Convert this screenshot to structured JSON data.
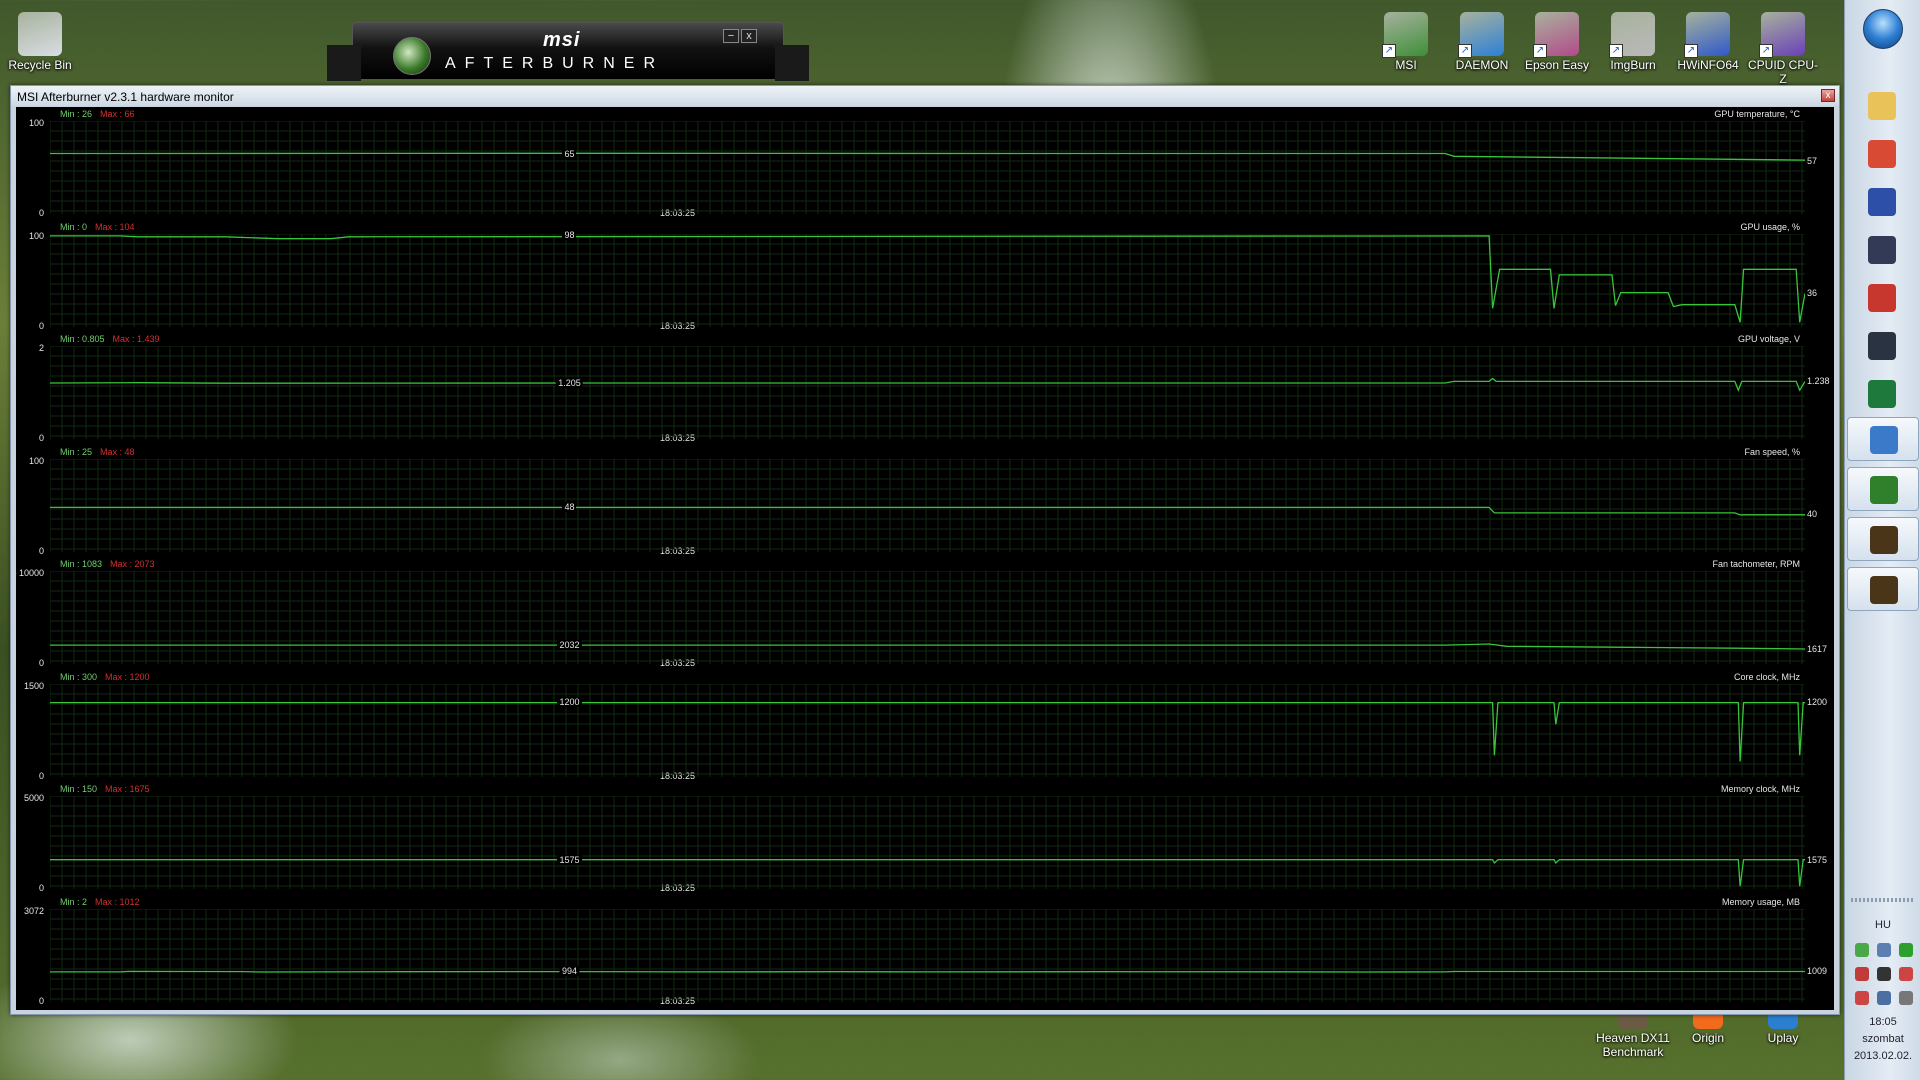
{
  "desktop": {
    "top_icons": [
      {
        "label": "Recycle Bin",
        "icon": "recycle-bin-icon",
        "color": "#d8dde3"
      },
      {
        "label": "MSI",
        "icon": "msi-icon",
        "color": "#3e8e3a"
      },
      {
        "label": "DAEMON",
        "icon": "daemon-tools-icon",
        "color": "#2c7fd8"
      },
      {
        "label": "Epson Easy",
        "icon": "epson-icon",
        "color": "#b24a8a"
      },
      {
        "label": "ImgBurn",
        "icon": "imgburn-icon",
        "color": "#b9b9b9"
      },
      {
        "label": "HWiNFO64",
        "icon": "hwinfo-icon",
        "color": "#2e58c9"
      },
      {
        "label": "CPUID CPU-Z",
        "icon": "cpuz-icon",
        "color": "#6a3fb8"
      }
    ],
    "bottom_icons": [
      {
        "label": "Heaven DX11 Benchmark",
        "icon": "heaven-icon",
        "color": "#6b5a44"
      },
      {
        "label": "Origin",
        "icon": "origin-icon",
        "color": "#f26a1b"
      },
      {
        "label": "Uplay",
        "icon": "uplay-icon",
        "color": "#2a7fd0"
      }
    ]
  },
  "afterburner_skin": {
    "logo_top": "msi",
    "logo_bottom": "AFTERBURNER",
    "minimize_glyph": "−",
    "close_glyph": "x"
  },
  "monitor_window": {
    "title": "MSI Afterburner v2.3.1 hardware monitor",
    "close_glyph": "x",
    "timestamp": "18:03:25",
    "graphs": [
      {
        "name": "GPU temperature, °C",
        "min_label": "Min : 26",
        "max_label": "Max : 66",
        "y_max": "100",
        "y_min": "0",
        "mid_value": "65",
        "current_value": "57",
        "range": [
          0,
          100
        ],
        "points": [
          [
            0,
            65
          ],
          [
            0.3,
            65.3
          ],
          [
            0.6,
            65
          ],
          [
            0.795,
            65
          ],
          [
            0.8,
            62
          ],
          [
            0.9,
            60
          ],
          [
            1,
            58
          ]
        ]
      },
      {
        "name": "GPU usage, %",
        "min_label": "Min : 0",
        "max_label": "Max : 104",
        "y_max": "100",
        "y_min": "0",
        "mid_value": "98",
        "current_value": "36",
        "range": [
          0,
          100
        ],
        "points": [
          [
            0,
            98
          ],
          [
            0.04,
            98
          ],
          [
            0.05,
            97
          ],
          [
            0.1,
            97
          ],
          [
            0.13,
            95
          ],
          [
            0.16,
            95
          ],
          [
            0.17,
            97
          ],
          [
            0.82,
            98
          ],
          [
            0.822,
            20
          ],
          [
            0.826,
            62
          ],
          [
            0.855,
            62
          ],
          [
            0.857,
            20
          ],
          [
            0.86,
            56
          ],
          [
            0.89,
            56
          ],
          [
            0.892,
            23
          ],
          [
            0.895,
            37
          ],
          [
            0.922,
            37
          ],
          [
            0.925,
            22
          ],
          [
            0.93,
            24
          ],
          [
            0.96,
            24
          ],
          [
            0.963,
            5
          ],
          [
            0.965,
            62
          ],
          [
            0.995,
            62
          ],
          [
            0.997,
            5
          ],
          [
            1,
            36
          ]
        ]
      },
      {
        "name": "GPU voltage, V",
        "min_label": "Min : 0.805",
        "max_label": "Max : 1.439",
        "y_max": "2",
        "y_min": "0",
        "mid_value": "1.205",
        "current_value": "1.238",
        "range": [
          0,
          2
        ],
        "points": [
          [
            0,
            1.205
          ],
          [
            0.05,
            1.21
          ],
          [
            0.1,
            1.2
          ],
          [
            0.3,
            1.205
          ],
          [
            0.795,
            1.205
          ],
          [
            0.8,
            1.238
          ],
          [
            0.82,
            1.24
          ],
          [
            0.822,
            1.3
          ],
          [
            0.824,
            1.238
          ],
          [
            0.96,
            1.238
          ],
          [
            0.962,
            1.05
          ],
          [
            0.964,
            1.238
          ],
          [
            0.995,
            1.238
          ],
          [
            0.997,
            1.05
          ],
          [
            1,
            1.238
          ]
        ]
      },
      {
        "name": "Fan speed, %",
        "min_label": "Min : 25",
        "max_label": "Max : 48",
        "y_max": "100",
        "y_min": "0",
        "mid_value": "48",
        "current_value": "40",
        "range": [
          0,
          100
        ],
        "points": [
          [
            0,
            48
          ],
          [
            0.82,
            48
          ],
          [
            0.823,
            42
          ],
          [
            0.96,
            42
          ],
          [
            0.963,
            40
          ],
          [
            1,
            40
          ]
        ]
      },
      {
        "name": "Fan tachometer, RPM",
        "min_label": "Min : 1083",
        "max_label": "Max : 2073",
        "y_max": "10000",
        "y_min": "0",
        "mid_value": "2032",
        "current_value": "1617",
        "range": [
          0,
          10000
        ],
        "points": [
          [
            0,
            2032
          ],
          [
            0.795,
            2032
          ],
          [
            0.82,
            2150
          ],
          [
            0.83,
            1900
          ],
          [
            0.9,
            1800
          ],
          [
            0.96,
            1700
          ],
          [
            1,
            1617
          ]
        ]
      },
      {
        "name": "Core clock, MHz",
        "min_label": "Min : 300",
        "max_label": "Max : 1200",
        "y_max": "1500",
        "y_min": "0",
        "mid_value": "1200",
        "current_value": "1200",
        "range": [
          0,
          1500
        ],
        "points": [
          [
            0,
            1200
          ],
          [
            0.822,
            1200
          ],
          [
            0.823,
            350
          ],
          [
            0.825,
            1200
          ],
          [
            0.857,
            1200
          ],
          [
            0.858,
            850
          ],
          [
            0.86,
            1200
          ],
          [
            0.962,
            1200
          ],
          [
            0.963,
            250
          ],
          [
            0.965,
            1200
          ],
          [
            0.996,
            1200
          ],
          [
            0.997,
            350
          ],
          [
            0.999,
            1200
          ],
          [
            1,
            1200
          ]
        ]
      },
      {
        "name": "Memory clock, MHz",
        "min_label": "Min : 150",
        "max_label": "Max : 1675",
        "y_max": "5000",
        "y_min": "0",
        "mid_value": "1575",
        "current_value": "1575",
        "range": [
          0,
          5000
        ],
        "points": [
          [
            0,
            1575
          ],
          [
            0.822,
            1575
          ],
          [
            0.823,
            1400
          ],
          [
            0.825,
            1575
          ],
          [
            0.857,
            1575
          ],
          [
            0.858,
            1400
          ],
          [
            0.86,
            1575
          ],
          [
            0.962,
            1575
          ],
          [
            0.963,
            150
          ],
          [
            0.965,
            1575
          ],
          [
            0.996,
            1575
          ],
          [
            0.997,
            150
          ],
          [
            0.999,
            1575
          ],
          [
            1,
            1575
          ]
        ]
      },
      {
        "name": "Memory usage, MB",
        "min_label": "Min : 2",
        "max_label": "Max : 1012",
        "y_max": "3072",
        "y_min": "0",
        "mid_value": "994",
        "current_value": "1009",
        "range": [
          0,
          3072
        ],
        "points": [
          [
            0,
            994
          ],
          [
            0.04,
            994
          ],
          [
            0.045,
            1010
          ],
          [
            0.11,
            1005
          ],
          [
            0.12,
            990
          ],
          [
            0.2,
            1000
          ],
          [
            0.3,
            1005
          ],
          [
            0.36,
            995
          ],
          [
            0.45,
            1000
          ],
          [
            0.5,
            994
          ],
          [
            0.6,
            1000
          ],
          [
            0.7,
            998
          ],
          [
            0.75,
            990
          ],
          [
            0.795,
            994
          ],
          [
            0.8,
            1009
          ],
          [
            1,
            1009
          ]
        ]
      }
    ]
  },
  "taskbar": {
    "pinned": [
      {
        "name": "explorer",
        "icon": "folder-icon",
        "color": "#e9c25a"
      },
      {
        "name": "chrome",
        "icon": "chrome-icon",
        "color": "#d94a35"
      },
      {
        "name": "save",
        "icon": "floppy-icon",
        "color": "#2d4fa8"
      },
      {
        "name": "media",
        "icon": "media-player-icon",
        "color": "#333a55"
      },
      {
        "name": "ccleaner",
        "icon": "ccleaner-icon",
        "color": "#c8372d"
      },
      {
        "name": "steam",
        "icon": "steam-icon",
        "color": "#2a3342"
      },
      {
        "name": "excel",
        "icon": "excel-icon",
        "color": "#1e7a3c"
      }
    ],
    "running": [
      {
        "name": "paint",
        "icon": "paint-icon",
        "color": "#3b7ac9"
      },
      {
        "name": "afterburner",
        "icon": "afterburner-icon",
        "color": "#2f7f2b"
      },
      {
        "name": "game1",
        "icon": "game-icon",
        "color": "#4a3518"
      },
      {
        "name": "game2",
        "icon": "game-icon",
        "color": "#4a3518"
      }
    ],
    "language": "HU",
    "time": "18:05",
    "day": "szombat",
    "date": "2013.02.02."
  },
  "colors": {
    "graph_line": "#39c43b",
    "grid": "#0f2a10"
  }
}
